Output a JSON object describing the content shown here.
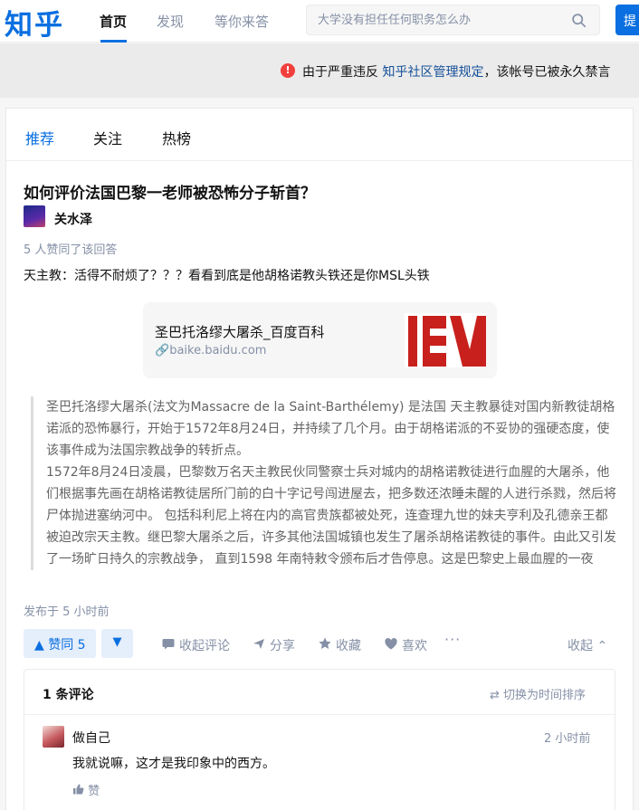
{
  "header": {
    "logo": "知乎",
    "nav": [
      "首页",
      "发现",
      "等你来答"
    ],
    "search_placeholder": "大学没有担任任何职务怎么办",
    "ask_label": "提",
    "icons": {
      "search": "search-icon"
    }
  },
  "banner": {
    "prefix": "由于严重违反",
    "link": "知乎社区管理规定",
    "suffix": "，该帐号已被永久禁言",
    "icon": "error-icon",
    "icon_color": "#f1403c"
  },
  "feed_tabs": [
    "推荐",
    "关注",
    "热榜"
  ],
  "answer": {
    "question": "如何评价法国巴黎一老师被恐怖分子斩首？",
    "author": "关水泽",
    "upvote_info": "5 人赞同了该回答",
    "text": "天主教：活得不耐烦了？？？看看到底是他胡格诺教头铁还是你MSL头铁",
    "link_card": {
      "title": "圣巴托洛缪大屠杀_百度百科",
      "url": "baike.baidu.com",
      "thumb_text": "IEV"
    },
    "quote": [
      "圣巴托洛缪大屠杀(法文为Massacre de la Saint-Barthélemy) 是法国 天主教暴徒对国内新教徒胡格诺派的恐怖暴行，开始于1572年8月24日，并持续了几个月。由于胡格诺派的不妥协的强硬态度，使该事件成为法国宗教战争的转折点。",
      "1572年8月24日凌晨，巴黎数万名天主教民伙同警察士兵对城内的胡格诺教徒进行血腥的大屠杀，他们根据事先画在胡格诺教徒居所门前的白十字记号闯进屋去，把多数还浓睡未醒的人进行杀戮，然后将尸体抛进塞纳河中。 包括科利尼上将在内的高官贵族都被处死，连查理九世的妹夫亨利及孔德亲王都被迫改宗天主教。继巴黎大屠杀之后，许多其他法国城镇也发生了屠杀胡格诺教徒的事件。由此又引发了一场旷日持久的宗教战争， 直到1598 年南特敕令颁布后才告停息。这是巴黎史上最血腥的一夜"
    ],
    "published": "发布于 5 小时前"
  },
  "actions": {
    "upvote": "▲ 赞同 5",
    "downvote": "▼",
    "items": [
      "收起评论",
      "分享",
      "收藏",
      "喜欢"
    ],
    "more": "···",
    "collapse": "收起 ⌃",
    "accent": "#0a6fe0"
  },
  "comments": {
    "count": "1 条评论",
    "sort": "⇄ 切换为时间排序",
    "list": [
      {
        "name": "做自己",
        "time": "2 小时前",
        "text": "我就说嘛，这才是我印象中的西方。",
        "like": "赞"
      }
    ]
  }
}
